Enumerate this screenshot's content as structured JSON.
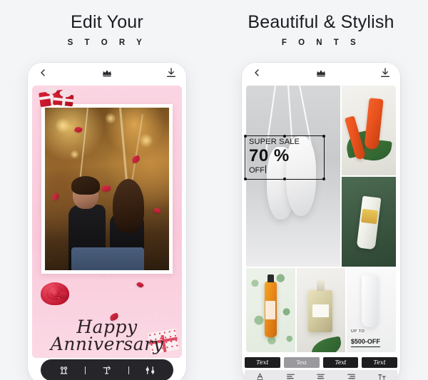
{
  "background_color": "#f4f5f7",
  "panels": [
    {
      "heading_line1": "Edit Your",
      "heading_line2": "S T O R Y",
      "app_bar": {
        "back_icon": "back-arrow-icon",
        "center_icon": "crown-icon",
        "save_icon": "download-icon"
      },
      "card": {
        "script_line1": "Happy",
        "script_line2": "Anniversary",
        "photo_subject": "couple-photo"
      },
      "toolbar": {
        "items": [
          {
            "icon": "sticker-icon",
            "label": "Sticker"
          },
          {
            "icon": "text-tool-icon",
            "label": "Text"
          },
          {
            "icon": "adjust-icon",
            "label": "Adjust"
          }
        ]
      }
    },
    {
      "heading_line1": "Beautiful & Stylish",
      "heading_line2": "F O N T S",
      "app_bar": {
        "back_icon": "back-arrow-icon",
        "center_icon": "crown-icon",
        "save_icon": "download-icon"
      },
      "collage": {
        "cells": [
          {
            "name": "sneakers-photo"
          },
          {
            "name": "orange-cosmetics-photo"
          },
          {
            "name": "green-skincare-photo"
          },
          {
            "name": "eucalyptus-bottle-photo"
          },
          {
            "name": "perfume-photo"
          },
          {
            "name": "white-tube-photo"
          }
        ],
        "promo": {
          "line1": "UP TO",
          "line2": "$500-OFF"
        }
      },
      "sale_overlay": {
        "line1": "SUPER SALE",
        "line2": "70 %",
        "line3": "OFF",
        "selected": true
      },
      "font_chips": [
        {
          "label": "Text",
          "style": "cursive",
          "selected": false
        },
        {
          "label": "Text",
          "style": "serif",
          "selected": true
        },
        {
          "label": "Text",
          "style": "script2",
          "selected": false
        },
        {
          "label": "Text",
          "style": "script3",
          "selected": false
        }
      ],
      "align_tools": [
        {
          "icon": "text-color-icon"
        },
        {
          "icon": "align-left-icon"
        },
        {
          "icon": "align-center-icon"
        },
        {
          "icon": "align-right-icon"
        },
        {
          "icon": "font-size-icon"
        }
      ]
    }
  ]
}
